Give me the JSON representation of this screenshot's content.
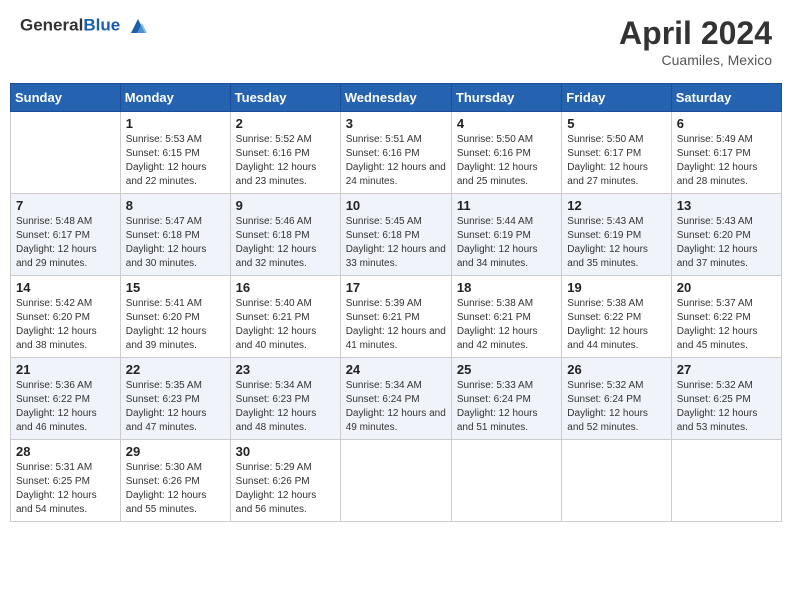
{
  "header": {
    "logo_text_general": "General",
    "logo_text_blue": "Blue",
    "month": "April 2024",
    "location": "Cuamiles, Mexico"
  },
  "weekdays": [
    "Sunday",
    "Monday",
    "Tuesday",
    "Wednesday",
    "Thursday",
    "Friday",
    "Saturday"
  ],
  "weeks": [
    [
      {
        "day": "",
        "sunrise": "",
        "sunset": "",
        "daylight": ""
      },
      {
        "day": "1",
        "sunrise": "Sunrise: 5:53 AM",
        "sunset": "Sunset: 6:15 PM",
        "daylight": "Daylight: 12 hours and 22 minutes."
      },
      {
        "day": "2",
        "sunrise": "Sunrise: 5:52 AM",
        "sunset": "Sunset: 6:16 PM",
        "daylight": "Daylight: 12 hours and 23 minutes."
      },
      {
        "day": "3",
        "sunrise": "Sunrise: 5:51 AM",
        "sunset": "Sunset: 6:16 PM",
        "daylight": "Daylight: 12 hours and 24 minutes."
      },
      {
        "day": "4",
        "sunrise": "Sunrise: 5:50 AM",
        "sunset": "Sunset: 6:16 PM",
        "daylight": "Daylight: 12 hours and 25 minutes."
      },
      {
        "day": "5",
        "sunrise": "Sunrise: 5:50 AM",
        "sunset": "Sunset: 6:17 PM",
        "daylight": "Daylight: 12 hours and 27 minutes."
      },
      {
        "day": "6",
        "sunrise": "Sunrise: 5:49 AM",
        "sunset": "Sunset: 6:17 PM",
        "daylight": "Daylight: 12 hours and 28 minutes."
      }
    ],
    [
      {
        "day": "7",
        "sunrise": "Sunrise: 5:48 AM",
        "sunset": "Sunset: 6:17 PM",
        "daylight": "Daylight: 12 hours and 29 minutes."
      },
      {
        "day": "8",
        "sunrise": "Sunrise: 5:47 AM",
        "sunset": "Sunset: 6:18 PM",
        "daylight": "Daylight: 12 hours and 30 minutes."
      },
      {
        "day": "9",
        "sunrise": "Sunrise: 5:46 AM",
        "sunset": "Sunset: 6:18 PM",
        "daylight": "Daylight: 12 hours and 32 minutes."
      },
      {
        "day": "10",
        "sunrise": "Sunrise: 5:45 AM",
        "sunset": "Sunset: 6:18 PM",
        "daylight": "Daylight: 12 hours and 33 minutes."
      },
      {
        "day": "11",
        "sunrise": "Sunrise: 5:44 AM",
        "sunset": "Sunset: 6:19 PM",
        "daylight": "Daylight: 12 hours and 34 minutes."
      },
      {
        "day": "12",
        "sunrise": "Sunrise: 5:43 AM",
        "sunset": "Sunset: 6:19 PM",
        "daylight": "Daylight: 12 hours and 35 minutes."
      },
      {
        "day": "13",
        "sunrise": "Sunrise: 5:43 AM",
        "sunset": "Sunset: 6:20 PM",
        "daylight": "Daylight: 12 hours and 37 minutes."
      }
    ],
    [
      {
        "day": "14",
        "sunrise": "Sunrise: 5:42 AM",
        "sunset": "Sunset: 6:20 PM",
        "daylight": "Daylight: 12 hours and 38 minutes."
      },
      {
        "day": "15",
        "sunrise": "Sunrise: 5:41 AM",
        "sunset": "Sunset: 6:20 PM",
        "daylight": "Daylight: 12 hours and 39 minutes."
      },
      {
        "day": "16",
        "sunrise": "Sunrise: 5:40 AM",
        "sunset": "Sunset: 6:21 PM",
        "daylight": "Daylight: 12 hours and 40 minutes."
      },
      {
        "day": "17",
        "sunrise": "Sunrise: 5:39 AM",
        "sunset": "Sunset: 6:21 PM",
        "daylight": "Daylight: 12 hours and 41 minutes."
      },
      {
        "day": "18",
        "sunrise": "Sunrise: 5:38 AM",
        "sunset": "Sunset: 6:21 PM",
        "daylight": "Daylight: 12 hours and 42 minutes."
      },
      {
        "day": "19",
        "sunrise": "Sunrise: 5:38 AM",
        "sunset": "Sunset: 6:22 PM",
        "daylight": "Daylight: 12 hours and 44 minutes."
      },
      {
        "day": "20",
        "sunrise": "Sunrise: 5:37 AM",
        "sunset": "Sunset: 6:22 PM",
        "daylight": "Daylight: 12 hours and 45 minutes."
      }
    ],
    [
      {
        "day": "21",
        "sunrise": "Sunrise: 5:36 AM",
        "sunset": "Sunset: 6:22 PM",
        "daylight": "Daylight: 12 hours and 46 minutes."
      },
      {
        "day": "22",
        "sunrise": "Sunrise: 5:35 AM",
        "sunset": "Sunset: 6:23 PM",
        "daylight": "Daylight: 12 hours and 47 minutes."
      },
      {
        "day": "23",
        "sunrise": "Sunrise: 5:34 AM",
        "sunset": "Sunset: 6:23 PM",
        "daylight": "Daylight: 12 hours and 48 minutes."
      },
      {
        "day": "24",
        "sunrise": "Sunrise: 5:34 AM",
        "sunset": "Sunset: 6:24 PM",
        "daylight": "Daylight: 12 hours and 49 minutes."
      },
      {
        "day": "25",
        "sunrise": "Sunrise: 5:33 AM",
        "sunset": "Sunset: 6:24 PM",
        "daylight": "Daylight: 12 hours and 51 minutes."
      },
      {
        "day": "26",
        "sunrise": "Sunrise: 5:32 AM",
        "sunset": "Sunset: 6:24 PM",
        "daylight": "Daylight: 12 hours and 52 minutes."
      },
      {
        "day": "27",
        "sunrise": "Sunrise: 5:32 AM",
        "sunset": "Sunset: 6:25 PM",
        "daylight": "Daylight: 12 hours and 53 minutes."
      }
    ],
    [
      {
        "day": "28",
        "sunrise": "Sunrise: 5:31 AM",
        "sunset": "Sunset: 6:25 PM",
        "daylight": "Daylight: 12 hours and 54 minutes."
      },
      {
        "day": "29",
        "sunrise": "Sunrise: 5:30 AM",
        "sunset": "Sunset: 6:26 PM",
        "daylight": "Daylight: 12 hours and 55 minutes."
      },
      {
        "day": "30",
        "sunrise": "Sunrise: 5:29 AM",
        "sunset": "Sunset: 6:26 PM",
        "daylight": "Daylight: 12 hours and 56 minutes."
      },
      {
        "day": "",
        "sunrise": "",
        "sunset": "",
        "daylight": ""
      },
      {
        "day": "",
        "sunrise": "",
        "sunset": "",
        "daylight": ""
      },
      {
        "day": "",
        "sunrise": "",
        "sunset": "",
        "daylight": ""
      },
      {
        "day": "",
        "sunrise": "",
        "sunset": "",
        "daylight": ""
      }
    ]
  ]
}
